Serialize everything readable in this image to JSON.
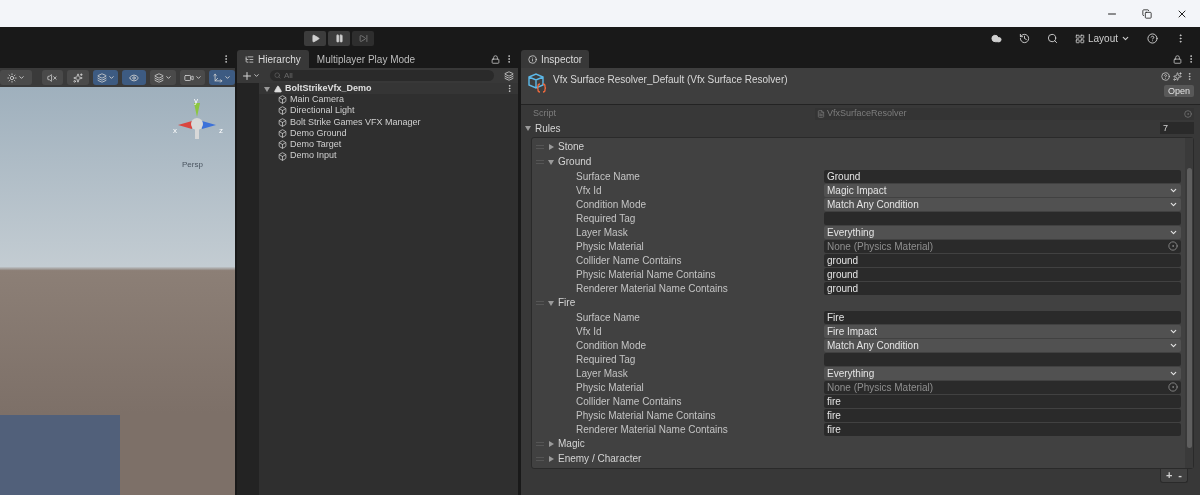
{
  "toolbar": {
    "layout_button": "Layout"
  },
  "scene": {
    "axes": [
      "y",
      "x",
      "z"
    ],
    "view_label": "Persp"
  },
  "hierarchy": {
    "tabs": [
      {
        "label": "Hierarchy",
        "selected": true
      },
      {
        "label": "Multiplayer Play Mode",
        "selected": false
      }
    ],
    "search": {
      "placeholder": "All"
    },
    "tree": [
      {
        "label": "BoltStrikeVfx_Demo",
        "expanded": true,
        "children": [
          {
            "label": "Main Camera"
          },
          {
            "label": "Directional Light"
          },
          {
            "label": "Bolt Strike Games VFX Manager"
          },
          {
            "label": "Demo Ground"
          },
          {
            "label": "Demo Target"
          },
          {
            "label": "Demo Input"
          }
        ]
      }
    ]
  },
  "inspector": {
    "tab": "Inspector",
    "title": "Vfx Surface Resolver_Default (Vfx Surface Resolver)",
    "open_button": "Open",
    "script": {
      "label": "Script",
      "value": "VfxSurfaceResolver"
    },
    "rules": {
      "label": "Rules",
      "expanded": true,
      "count": "7",
      "items": [
        {
          "label": "Stone",
          "expanded": false
        },
        {
          "label": "Ground",
          "expanded": true,
          "fields": [
            {
              "label": "Surface Name",
              "kind": "text",
              "value": "Ground"
            },
            {
              "label": "Vfx Id",
              "kind": "dropdown",
              "value": "Magic Impact"
            },
            {
              "label": "Condition Mode",
              "kind": "dropdown",
              "value": "Match Any Condition"
            },
            {
              "label": "Required Tag",
              "kind": "text"
            },
            {
              "label": "Layer Mask",
              "kind": "dropdown",
              "value": "Everything"
            },
            {
              "label": "Physic Material",
              "kind": "object",
              "value": "None (Physics Material)"
            },
            {
              "label": "Collider Name Contains",
              "kind": "text",
              "value": "ground"
            },
            {
              "label": "Physic Material Name Contains",
              "kind": "text",
              "value": "ground"
            },
            {
              "label": "Renderer Material Name Contains",
              "kind": "text",
              "value": "ground"
            }
          ]
        },
        {
          "label": "Fire",
          "expanded": true,
          "fields": [
            {
              "label": "Surface Name",
              "kind": "text",
              "value": "Fire"
            },
            {
              "label": "Vfx Id",
              "kind": "dropdown",
              "value": "Fire Impact"
            },
            {
              "label": "Condition Mode",
              "kind": "dropdown",
              "value": "Match Any Condition"
            },
            {
              "label": "Required Tag",
              "kind": "text"
            },
            {
              "label": "Layer Mask",
              "kind": "dropdown",
              "value": "Everything"
            },
            {
              "label": "Physic Material",
              "kind": "object",
              "value": "None (Physics Material)"
            },
            {
              "label": "Collider Name Contains",
              "kind": "text",
              "value": "fire"
            },
            {
              "label": "Physic Material Name Contains",
              "kind": "text",
              "value": "fire"
            },
            {
              "label": "Renderer Material Name Contains",
              "kind": "text",
              "value": "fire"
            }
          ]
        },
        {
          "label": "Magic",
          "expanded": false
        },
        {
          "label": "Enemy / Character",
          "expanded": false
        }
      ]
    },
    "list_buttons": [
      "+",
      "-"
    ]
  }
}
